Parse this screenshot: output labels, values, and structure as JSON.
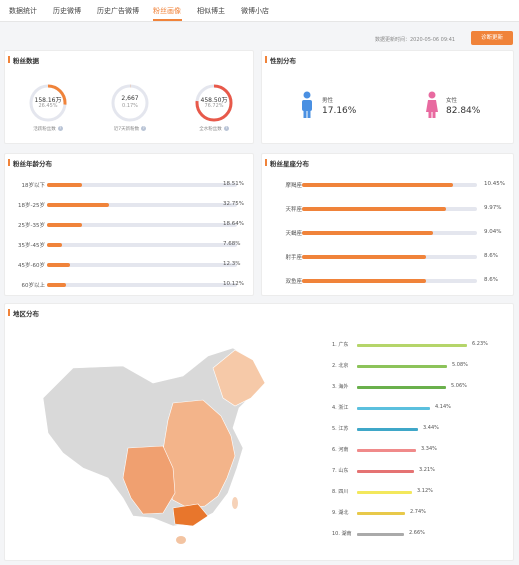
{
  "tabs": [
    {
      "label": "数据统计",
      "active": false
    },
    {
      "label": "历史微博",
      "active": false
    },
    {
      "label": "历史广告微博",
      "active": false
    },
    {
      "label": "粉丝画像",
      "active": true
    },
    {
      "label": "相似博主",
      "active": false
    },
    {
      "label": "微博小店",
      "active": false
    }
  ],
  "update_time": "数据更新时间：2020-05-06 09:41",
  "diagnose_button": "诊断更新",
  "colors": {
    "accent": "#f0833a",
    "male": "#4a90e2",
    "female": "#e86aa0",
    "track": "#e4e6ee"
  },
  "fans_data": {
    "title": "粉丝数据",
    "items": [
      {
        "value": "158.16万",
        "percent": "26.45%",
        "label": "活跃粉丝数",
        "ratio": 0.2645
      },
      {
        "value": "2,667",
        "percent": "0.17%",
        "label": "近7天新粉数",
        "ratio": 0.0017
      },
      {
        "value": "458.50万",
        "percent": "76.72%",
        "label": "全水粉丝数",
        "ratio": 0.7672
      }
    ],
    "info_icon": "question-icon"
  },
  "gender": {
    "title": "性别分布",
    "male": {
      "label": "男性",
      "percent": "17.16%",
      "icon": "male-icon"
    },
    "female": {
      "label": "女性",
      "percent": "82.84%",
      "icon": "female-icon"
    }
  },
  "age": {
    "title": "粉丝年龄分布",
    "items": [
      {
        "label": "18岁以下",
        "value": "18.51%",
        "ratio": 0.1851
      },
      {
        "label": "18岁-25岁",
        "value": "32.75%",
        "ratio": 0.3275
      },
      {
        "label": "25岁-35岁",
        "value": "18.64%",
        "ratio": 0.1864
      },
      {
        "label": "35岁-45岁",
        "value": "7.68%",
        "ratio": 0.0768
      },
      {
        "label": "45岁-60岁",
        "value": "12.3%",
        "ratio": 0.123
      },
      {
        "label": "60岁以上",
        "value": "10.12%",
        "ratio": 0.1012
      }
    ]
  },
  "zodiac": {
    "title": "粉丝星座分布",
    "items": [
      {
        "label": "摩羯座",
        "value": "10.45%",
        "ratio": 0.1045
      },
      {
        "label": "天秤座",
        "value": "9.97%",
        "ratio": 0.0997
      },
      {
        "label": "天蝎座",
        "value": "9.04%",
        "ratio": 0.0904
      },
      {
        "label": "射手座",
        "value": "8.6%",
        "ratio": 0.086
      },
      {
        "label": "双鱼座",
        "value": "8.6%",
        "ratio": 0.086
      }
    ]
  },
  "region": {
    "title": "地区分布",
    "items": [
      {
        "label": "1. 广东",
        "value": "6.23%",
        "ratio": 0.0623,
        "color": "#b5d56a"
      },
      {
        "label": "2. 北京",
        "value": "5.08%",
        "ratio": 0.0508,
        "color": "#8cc35a"
      },
      {
        "label": "3. 海外",
        "value": "5.06%",
        "ratio": 0.0506,
        "color": "#6ab04c"
      },
      {
        "label": "4. 浙江",
        "value": "4.14%",
        "ratio": 0.0414,
        "color": "#5bc0de"
      },
      {
        "label": "5. 江苏",
        "value": "3.44%",
        "ratio": 0.0344,
        "color": "#3fa7c8"
      },
      {
        "label": "6. 河南",
        "value": "3.34%",
        "ratio": 0.0334,
        "color": "#f08a8a"
      },
      {
        "label": "7. 山东",
        "value": "3.21%",
        "ratio": 0.0321,
        "color": "#e57373"
      },
      {
        "label": "8. 四川",
        "value": "3.12%",
        "ratio": 0.0312,
        "color": "#f3e85c"
      },
      {
        "label": "9. 湖北",
        "value": "2.74%",
        "ratio": 0.0274,
        "color": "#e8c94a"
      },
      {
        "label": "10. 湖南",
        "value": "2.66%",
        "ratio": 0.0266,
        "color": "#aaaaaa"
      }
    ]
  }
}
